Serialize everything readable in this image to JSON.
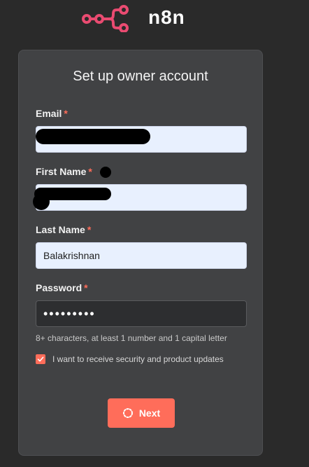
{
  "brand": {
    "name": "n8n",
    "accent_color": "#ff6d5a",
    "logo_color": "#ea4b71"
  },
  "form": {
    "title": "Set up owner account",
    "required_marker": "*",
    "email": {
      "label": "Email",
      "value": ""
    },
    "first_name": {
      "label": "First Name",
      "value": ""
    },
    "last_name": {
      "label": "Last Name",
      "value": "Balakrishnan"
    },
    "password": {
      "label": "Password",
      "value": "•••••••••",
      "hint": "8+ characters, at least 1 number and 1 capital letter"
    },
    "updates_checkbox": {
      "label": "I want to receive security and product updates",
      "checked": true
    },
    "submit": {
      "label": "Next",
      "icon": "spinner-icon"
    }
  }
}
